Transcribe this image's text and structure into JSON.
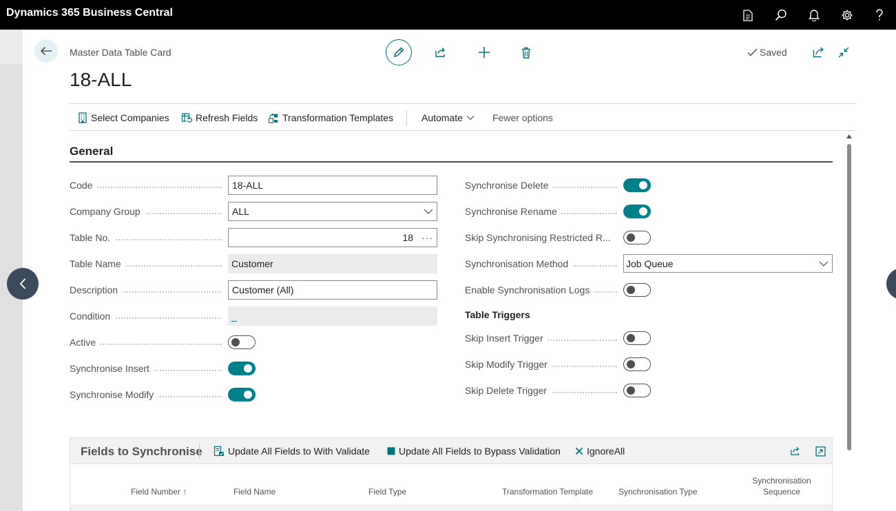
{
  "app": {
    "title": "Dynamics 365 Business Central"
  },
  "page": {
    "breadcrumb": "Master Data Table Card",
    "title": "18-ALL",
    "saved_label": "Saved"
  },
  "actions": {
    "select_companies": "Select Companies",
    "refresh_fields": "Refresh Fields",
    "transformation_templates": "Transformation Templates",
    "automate": "Automate",
    "fewer_options": "Fewer options"
  },
  "general": {
    "heading": "General",
    "code": {
      "label": "Code",
      "value": "18-ALL"
    },
    "company_group": {
      "label": "Company Group",
      "value": "ALL"
    },
    "table_no": {
      "label": "Table No.",
      "value": "18"
    },
    "table_name": {
      "label": "Table Name",
      "value": "Customer"
    },
    "description": {
      "label": "Description",
      "value": "Customer (All)"
    },
    "condition": {
      "label": "Condition",
      "value": "_"
    },
    "active": {
      "label": "Active",
      "on": false
    },
    "sync_insert": {
      "label": "Synchronise Insert",
      "on": true
    },
    "sync_modify": {
      "label": "Synchronise Modify",
      "on": true
    },
    "sync_delete": {
      "label": "Synchronise Delete",
      "on": true
    },
    "sync_rename": {
      "label": "Synchronise Rename",
      "on": true
    },
    "skip_restricted": {
      "label": "Skip Synchronising Restricted R...",
      "on": false
    },
    "sync_method": {
      "label": "Synchronisation Method",
      "value": "Job Queue"
    },
    "enable_logs": {
      "label": "Enable Synchronisation Logs",
      "on": false
    },
    "table_triggers_heading": "Table Triggers",
    "skip_insert_trigger": {
      "label": "Skip Insert Trigger",
      "on": false
    },
    "skip_modify_trigger": {
      "label": "Skip Modify Trigger",
      "on": false
    },
    "skip_delete_trigger": {
      "label": "Skip Delete Trigger",
      "on": false
    }
  },
  "fields_part": {
    "title": "Fields to Synchronise",
    "update_with_validate": "Update All Fields to With Validate",
    "update_bypass": "Update All Fields to Bypass Validation",
    "ignore_all": "IgnoreAll",
    "columns": {
      "field_number": "Field Number",
      "sort_arrow": "↑",
      "field_name": "Field Name",
      "field_type": "Field Type",
      "transformation_template": "Transformation Template",
      "sync_type": "Synchronisation Type",
      "sync_sequence_1": "Synchronisation",
      "sync_sequence_2": "Sequence"
    }
  },
  "colors": {
    "accent": "#00808a",
    "topbar": "#000000",
    "nav_circle": "#3b4a5c"
  }
}
